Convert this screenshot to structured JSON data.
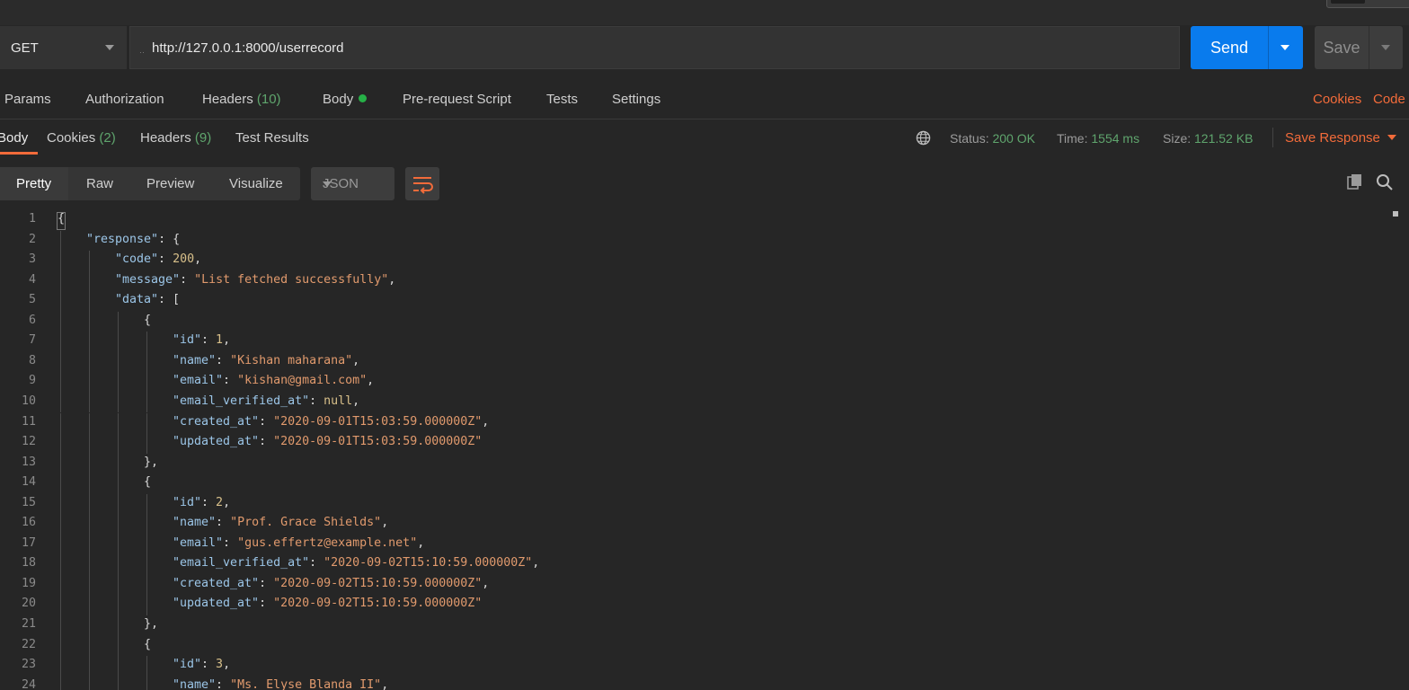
{
  "request": {
    "method": "GET",
    "url": "http://127.0.0.1:8000/userrecord",
    "send_label": "Send",
    "save_label": "Save"
  },
  "request_tabs": {
    "params": "Params",
    "authorization": "Authorization",
    "headers": "Headers",
    "headers_count": "(10)",
    "body": "Body",
    "prerequest": "Pre-request Script",
    "tests": "Tests",
    "settings": "Settings",
    "cookies": "Cookies",
    "code": "Code"
  },
  "response_tabs": {
    "body": "Body",
    "cookies": "Cookies",
    "cookies_count": "(2)",
    "headers": "Headers",
    "headers_count": "(9)",
    "test_results": "Test Results"
  },
  "status": {
    "status_label": "Status:",
    "status_value": "200 OK",
    "time_label": "Time:",
    "time_value": "1554 ms",
    "size_label": "Size:",
    "size_value": "121.52 KB",
    "save_response": "Save Response"
  },
  "view": {
    "pretty": "Pretty",
    "raw": "Raw",
    "preview": "Preview",
    "visualize": "Visualize",
    "format": "JSON"
  },
  "colors": {
    "accent": "#f26b3a",
    "send_blue": "#097bed",
    "success_green": "#5fa56d",
    "json_key": "#9cc6e8",
    "json_string": "#e19a6d",
    "json_number": "#d8c08a"
  },
  "code_lines": [
    {
      "n": "1",
      "indent": 0,
      "parts": [
        {
          "t": "p",
          "v": "{"
        }
      ]
    },
    {
      "n": "2",
      "indent": 1,
      "parts": [
        {
          "t": "k",
          "v": "\"response\""
        },
        {
          "t": "p",
          "v": ": {"
        }
      ]
    },
    {
      "n": "3",
      "indent": 2,
      "parts": [
        {
          "t": "k",
          "v": "\"code\""
        },
        {
          "t": "p",
          "v": ": "
        },
        {
          "t": "n",
          "v": "200"
        },
        {
          "t": "p",
          "v": ","
        }
      ]
    },
    {
      "n": "4",
      "indent": 2,
      "parts": [
        {
          "t": "k",
          "v": "\"message\""
        },
        {
          "t": "p",
          "v": ": "
        },
        {
          "t": "s",
          "v": "\"List fetched successfully\""
        },
        {
          "t": "p",
          "v": ","
        }
      ]
    },
    {
      "n": "5",
      "indent": 2,
      "parts": [
        {
          "t": "k",
          "v": "\"data\""
        },
        {
          "t": "p",
          "v": ": ["
        }
      ]
    },
    {
      "n": "6",
      "indent": 3,
      "parts": [
        {
          "t": "p",
          "v": "{"
        }
      ]
    },
    {
      "n": "7",
      "indent": 4,
      "parts": [
        {
          "t": "k",
          "v": "\"id\""
        },
        {
          "t": "p",
          "v": ": "
        },
        {
          "t": "n",
          "v": "1"
        },
        {
          "t": "p",
          "v": ","
        }
      ]
    },
    {
      "n": "8",
      "indent": 4,
      "parts": [
        {
          "t": "k",
          "v": "\"name\""
        },
        {
          "t": "p",
          "v": ": "
        },
        {
          "t": "s",
          "v": "\"Kishan maharana\""
        },
        {
          "t": "p",
          "v": ","
        }
      ]
    },
    {
      "n": "9",
      "indent": 4,
      "parts": [
        {
          "t": "k",
          "v": "\"email\""
        },
        {
          "t": "p",
          "v": ": "
        },
        {
          "t": "s",
          "v": "\"kishan@gmail.com\""
        },
        {
          "t": "p",
          "v": ","
        }
      ]
    },
    {
      "n": "10",
      "indent": 4,
      "parts": [
        {
          "t": "k",
          "v": "\"email_verified_at\""
        },
        {
          "t": "p",
          "v": ": "
        },
        {
          "t": "n",
          "v": "null"
        },
        {
          "t": "p",
          "v": ","
        }
      ]
    },
    {
      "n": "11",
      "indent": 4,
      "parts": [
        {
          "t": "k",
          "v": "\"created_at\""
        },
        {
          "t": "p",
          "v": ": "
        },
        {
          "t": "s",
          "v": "\"2020-09-01T15:03:59.000000Z\""
        },
        {
          "t": "p",
          "v": ","
        }
      ]
    },
    {
      "n": "12",
      "indent": 4,
      "parts": [
        {
          "t": "k",
          "v": "\"updated_at\""
        },
        {
          "t": "p",
          "v": ": "
        },
        {
          "t": "s",
          "v": "\"2020-09-01T15:03:59.000000Z\""
        }
      ]
    },
    {
      "n": "13",
      "indent": 3,
      "parts": [
        {
          "t": "p",
          "v": "},"
        }
      ]
    },
    {
      "n": "14",
      "indent": 3,
      "parts": [
        {
          "t": "p",
          "v": "{"
        }
      ]
    },
    {
      "n": "15",
      "indent": 4,
      "parts": [
        {
          "t": "k",
          "v": "\"id\""
        },
        {
          "t": "p",
          "v": ": "
        },
        {
          "t": "n",
          "v": "2"
        },
        {
          "t": "p",
          "v": ","
        }
      ]
    },
    {
      "n": "16",
      "indent": 4,
      "parts": [
        {
          "t": "k",
          "v": "\"name\""
        },
        {
          "t": "p",
          "v": ": "
        },
        {
          "t": "s",
          "v": "\"Prof. Grace Shields\""
        },
        {
          "t": "p",
          "v": ","
        }
      ]
    },
    {
      "n": "17",
      "indent": 4,
      "parts": [
        {
          "t": "k",
          "v": "\"email\""
        },
        {
          "t": "p",
          "v": ": "
        },
        {
          "t": "s",
          "v": "\"gus.effertz@example.net\""
        },
        {
          "t": "p",
          "v": ","
        }
      ]
    },
    {
      "n": "18",
      "indent": 4,
      "parts": [
        {
          "t": "k",
          "v": "\"email_verified_at\""
        },
        {
          "t": "p",
          "v": ": "
        },
        {
          "t": "s",
          "v": "\"2020-09-02T15:10:59.000000Z\""
        },
        {
          "t": "p",
          "v": ","
        }
      ]
    },
    {
      "n": "19",
      "indent": 4,
      "parts": [
        {
          "t": "k",
          "v": "\"created_at\""
        },
        {
          "t": "p",
          "v": ": "
        },
        {
          "t": "s",
          "v": "\"2020-09-02T15:10:59.000000Z\""
        },
        {
          "t": "p",
          "v": ","
        }
      ]
    },
    {
      "n": "20",
      "indent": 4,
      "parts": [
        {
          "t": "k",
          "v": "\"updated_at\""
        },
        {
          "t": "p",
          "v": ": "
        },
        {
          "t": "s",
          "v": "\"2020-09-02T15:10:59.000000Z\""
        }
      ]
    },
    {
      "n": "21",
      "indent": 3,
      "parts": [
        {
          "t": "p",
          "v": "},"
        }
      ]
    },
    {
      "n": "22",
      "indent": 3,
      "parts": [
        {
          "t": "p",
          "v": "{"
        }
      ]
    },
    {
      "n": "23",
      "indent": 4,
      "parts": [
        {
          "t": "k",
          "v": "\"id\""
        },
        {
          "t": "p",
          "v": ": "
        },
        {
          "t": "n",
          "v": "3"
        },
        {
          "t": "p",
          "v": ","
        }
      ]
    },
    {
      "n": "24",
      "indent": 4,
      "parts": [
        {
          "t": "k",
          "v": "\"name\""
        },
        {
          "t": "p",
          "v": ": "
        },
        {
          "t": "s",
          "v": "\"Ms. Elyse Blanda II\""
        },
        {
          "t": "p",
          "v": ","
        }
      ]
    }
  ]
}
